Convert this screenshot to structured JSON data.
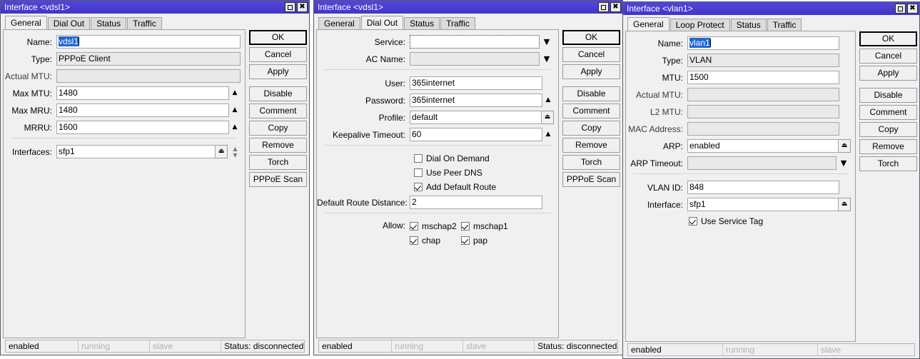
{
  "windows": [
    {
      "title": "Interface <vdsl1>",
      "tabs": [
        {
          "label": "General",
          "active": true
        },
        {
          "label": "Dial Out",
          "active": false
        },
        {
          "label": "Status",
          "active": false
        },
        {
          "label": "Traffic",
          "active": false
        }
      ],
      "fields": {
        "name_label": "Name:",
        "name_value": "vdsl1",
        "type_label": "Type:",
        "type_value": "PPPoE Client",
        "actual_mtu_label": "Actual MTU:",
        "actual_mtu_value": "",
        "max_mtu_label": "Max MTU:",
        "max_mtu_value": "1480",
        "max_mru_label": "Max MRU:",
        "max_mru_value": "1480",
        "mrru_label": "MRRU:",
        "mrru_value": "1600",
        "interfaces_label": "Interfaces:",
        "interfaces_value": "sfp1"
      },
      "buttons": [
        "OK",
        "Cancel",
        "Apply",
        "Disable",
        "Comment",
        "Copy",
        "Remove",
        "Torch",
        "PPPoE Scan"
      ],
      "status": [
        "enabled",
        "running",
        "slave",
        "Status: disconnected"
      ]
    },
    {
      "title": "Interface <vdsl1>",
      "tabs": [
        {
          "label": "General",
          "active": false
        },
        {
          "label": "Dial Out",
          "active": true
        },
        {
          "label": "Status",
          "active": false
        },
        {
          "label": "Traffic",
          "active": false
        }
      ],
      "fields": {
        "service_label": "Service:",
        "service_value": "",
        "ac_name_label": "AC Name:",
        "ac_name_value": "",
        "user_label": "User:",
        "user_value": "365internet",
        "password_label": "Password:",
        "password_value": "365internet",
        "profile_label": "Profile:",
        "profile_value": "default",
        "keepalive_label": "Keepalive Timeout:",
        "keepalive_value": "60",
        "default_route_distance_label": "Default Route Distance:",
        "default_route_distance_value": "2",
        "allow_label": "Allow:"
      },
      "checkboxes": [
        {
          "label": "Dial On Demand",
          "checked": false
        },
        {
          "label": "Use Peer DNS",
          "checked": false
        },
        {
          "label": "Add Default Route",
          "checked": true
        }
      ],
      "allow": [
        {
          "label": "mschap2",
          "checked": true
        },
        {
          "label": "mschap1",
          "checked": true
        },
        {
          "label": "chap",
          "checked": true
        },
        {
          "label": "pap",
          "checked": true
        }
      ],
      "buttons": [
        "OK",
        "Cancel",
        "Apply",
        "Disable",
        "Comment",
        "Copy",
        "Remove",
        "Torch",
        "PPPoE Scan"
      ],
      "status": [
        "enabled",
        "running",
        "slave",
        "Status: disconnected"
      ]
    },
    {
      "title": "Interface <vlan1>",
      "tabs": [
        {
          "label": "General",
          "active": true
        },
        {
          "label": "Loop Protect",
          "active": false
        },
        {
          "label": "Status",
          "active": false
        },
        {
          "label": "Traffic",
          "active": false
        }
      ],
      "fields": {
        "name_label": "Name:",
        "name_value": "vlan1",
        "type_label": "Type:",
        "type_value": "VLAN",
        "mtu_label": "MTU:",
        "mtu_value": "1500",
        "actual_mtu_label": "Actual MTU:",
        "actual_mtu_value": "",
        "l2_mtu_label": "L2 MTU:",
        "l2_mtu_value": "",
        "mac_address_label": "MAC Address:",
        "mac_address_value": "",
        "arp_label": "ARP:",
        "arp_value": "enabled",
        "arp_timeout_label": "ARP Timeout:",
        "arp_timeout_value": "",
        "vlan_id_label": "VLAN ID:",
        "vlan_id_value": "848",
        "interface_label": "Interface:",
        "interface_value": "sfp1"
      },
      "checkboxes": [
        {
          "label": "Use Service Tag",
          "checked": true
        }
      ],
      "buttons": [
        "OK",
        "Cancel",
        "Apply",
        "Disable",
        "Comment",
        "Copy",
        "Remove",
        "Torch"
      ],
      "status": [
        "enabled",
        "running",
        "slave"
      ]
    }
  ],
  "icons": {
    "maximize": "maximize-icon",
    "close": "✖",
    "spin_up": "▲",
    "caret_down": "▼",
    "dropdown": "▼",
    "up_arrow": "▲",
    "down_arrow": "▼"
  },
  "colors": {
    "titlebar": "#4a3fd0",
    "selection": "#1f67d2",
    "window_bg": "#f0f0f0",
    "field_bg": "#ffffff",
    "readonly_bg": "#e9e9e9"
  }
}
